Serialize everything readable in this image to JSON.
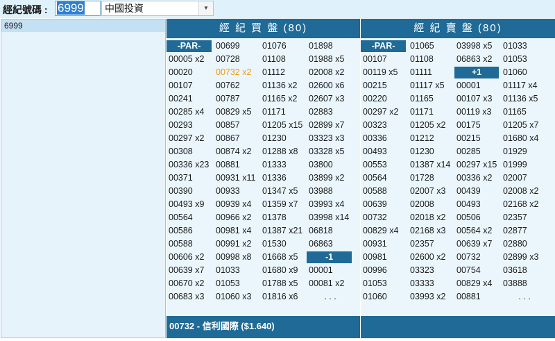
{
  "toolbar": {
    "label": "經紀號碼 :",
    "code_value": "6999",
    "select_value": "中國投資"
  },
  "left_panel": {
    "items": [
      "6999"
    ]
  },
  "buy": {
    "header": "經 紀 買 盤 (80)",
    "footer": "00732 - 信利國際 ($1.640)",
    "rows": [
      [
        "-PAR-",
        "00699",
        "01076",
        "01898"
      ],
      [
        "00005 x2",
        "00728",
        "01108",
        "01988 x5"
      ],
      [
        "00020",
        "00732 x2",
        "01112",
        "02008 x2"
      ],
      [
        "00107",
        "00762",
        "01136 x2",
        "02600 x6"
      ],
      [
        "00241",
        "00787",
        "01165 x2",
        "02607 x3"
      ],
      [
        "00285 x4",
        "00829 x5",
        "01171",
        "02883"
      ],
      [
        "00293",
        "00857",
        "01205 x15",
        "02899 x7"
      ],
      [
        "00297 x2",
        "00867",
        "01230",
        "03323 x3"
      ],
      [
        "00308",
        "00874 x2",
        "01288 x8",
        "03328 x5"
      ],
      [
        "00336 x23",
        "00881",
        "01333",
        "03800"
      ],
      [
        "00371",
        "00931 x11",
        "01336",
        "03899 x2"
      ],
      [
        "00390",
        "00933",
        "01347 x5",
        "03988"
      ],
      [
        "00493 x9",
        "00939 x4",
        "01359 x7",
        "03993 x4"
      ],
      [
        "00564",
        "00966 x2",
        "01378",
        "03998 x14"
      ],
      [
        "00586",
        "00981 x4",
        "01387 x21",
        "06818"
      ],
      [
        "00588",
        "00991 x2",
        "01530",
        "06863"
      ],
      [
        "00606 x2",
        "00998 x8",
        "01668 x5",
        "-1"
      ],
      [
        "00639 x7",
        "01033",
        "01680 x9",
        "00001"
      ],
      [
        "00670 x2",
        "01053",
        "01788 x5",
        "00081 x2"
      ],
      [
        "00683 x3",
        "01060 x3",
        "01816 x6",
        ". . ."
      ]
    ]
  },
  "sell": {
    "header": "經 紀 賣 盤 (80)",
    "footer": "",
    "rows": [
      [
        "-PAR-",
        "01065",
        "03998 x5",
        "01033"
      ],
      [
        "00107",
        "01108",
        "06863 x2",
        "01053"
      ],
      [
        "00119 x5",
        "01111",
        "+1",
        "01060"
      ],
      [
        "00215",
        "01117 x5",
        "00001",
        "01117 x4"
      ],
      [
        "00220",
        "01165",
        "00107 x3",
        "01136 x5"
      ],
      [
        "00297 x2",
        "01171",
        "00119 x3",
        "01165"
      ],
      [
        "00323",
        "01205 x2",
        "00175",
        "01205 x7"
      ],
      [
        "00336",
        "01212",
        "00215",
        "01680 x4"
      ],
      [
        "00493",
        "01230",
        "00285",
        "01929"
      ],
      [
        "00553",
        "01387 x14",
        "00297 x15",
        "01999"
      ],
      [
        "00564",
        "01728",
        "00336 x2",
        "02007"
      ],
      [
        "00588",
        "02007 x3",
        "00439",
        "02008 x2"
      ],
      [
        "00639",
        "02008",
        "00493",
        "02168 x2"
      ],
      [
        "00732",
        "02018 x2",
        "00506",
        "02357"
      ],
      [
        "00829 x4",
        "02168 x3",
        "00564 x2",
        "02877"
      ],
      [
        "00931",
        "02357",
        "00639 x7",
        "02880"
      ],
      [
        "00981",
        "02600 x2",
        "00732",
        "02899 x3"
      ],
      [
        "00996",
        "03323",
        "00754",
        "03618"
      ],
      [
        "01053",
        "03333",
        "00829 x4",
        "03888"
      ],
      [
        "01060",
        "03993 x2",
        "00881",
        ". . ."
      ]
    ]
  },
  "colors": {
    "header_bg": "#1f6a96",
    "panel_bg": "#eaf6fc",
    "highlight": "#f39a0e"
  },
  "highlighted_cell": "00732 x2"
}
